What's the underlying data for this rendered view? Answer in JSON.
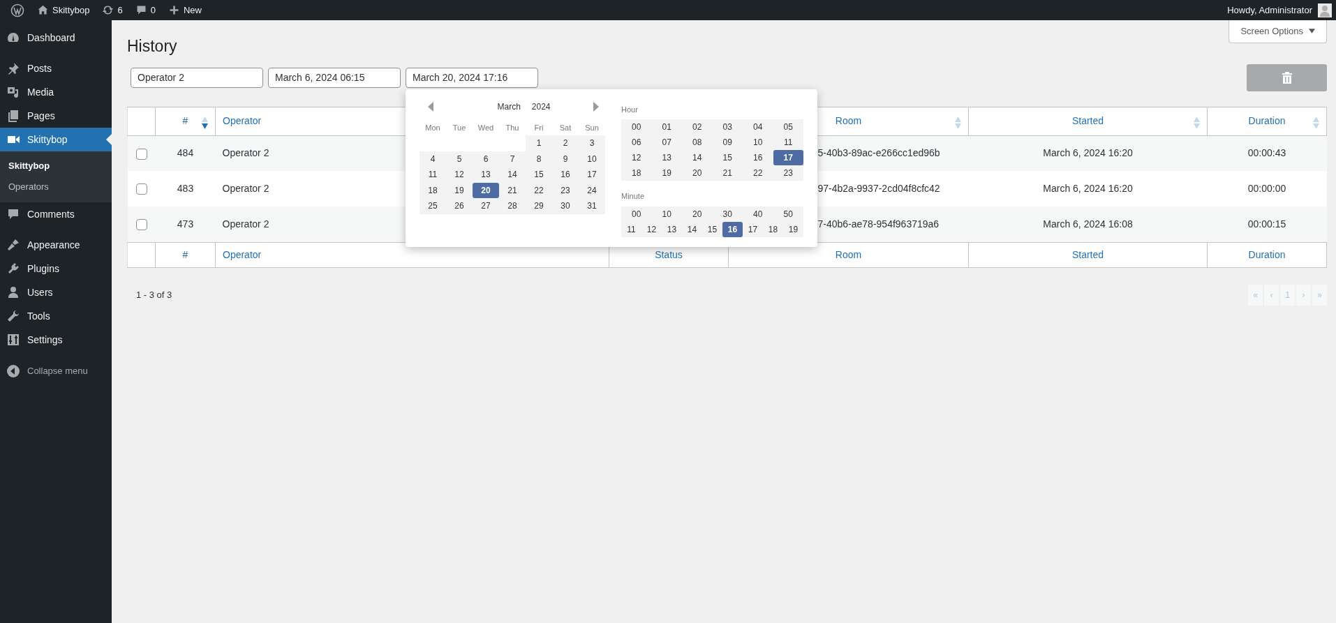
{
  "admin_bar": {
    "items": [
      {
        "kind": "logo"
      },
      {
        "kind": "home",
        "label": "Skittybop"
      },
      {
        "kind": "updates",
        "label": "6"
      },
      {
        "kind": "comments",
        "label": "0"
      },
      {
        "kind": "new",
        "label": "New"
      }
    ],
    "greeting": "Howdy, Administrator"
  },
  "sidebar": {
    "items": [
      {
        "kind": "dashboard",
        "label": "Dashboard",
        "selected": false
      },
      {
        "kind": "posts",
        "label": "Posts",
        "selected": false
      },
      {
        "kind": "media",
        "label": "Media",
        "selected": false
      },
      {
        "kind": "pages",
        "label": "Pages",
        "selected": false
      },
      {
        "kind": "video",
        "label": "Skittybop",
        "selected": true,
        "children": [
          {
            "label": "Skittybop",
            "selected": true
          },
          {
            "label": "Operators",
            "selected": false
          }
        ]
      },
      {
        "kind": "comments",
        "label": "Comments",
        "selected": false
      },
      {
        "kind": "appearance",
        "label": "Appearance",
        "selected": false
      },
      {
        "kind": "plugins",
        "label": "Plugins",
        "selected": false
      },
      {
        "kind": "users",
        "label": "Users",
        "selected": false
      },
      {
        "kind": "tools",
        "label": "Tools",
        "selected": false
      },
      {
        "kind": "settings",
        "label": "Settings",
        "selected": false
      }
    ],
    "collapse": "Collapse menu"
  },
  "screen_options": "Screen Options",
  "page_title": "History",
  "filters": [
    {
      "value": "Operator 2",
      "open": false
    },
    {
      "value": "March 6, 2024 06:15",
      "open": false
    },
    {
      "value": "March 20, 2024 17:16",
      "open": true
    }
  ],
  "delete_button": {
    "disabled": true
  },
  "date_picker": {
    "month": "March",
    "year": "2024",
    "weekdays": [
      "Mon",
      "Tue",
      "Wed",
      "Thu",
      "Fri",
      "Sat",
      "Sun"
    ],
    "weeks": [
      [
        {
          "kind": "blank"
        },
        {
          "kind": "blank"
        },
        {
          "kind": "blank"
        },
        {
          "kind": "blank"
        },
        {
          "day": "1",
          "selected": false
        },
        {
          "day": "2",
          "selected": false
        },
        {
          "day": "3",
          "selected": false
        }
      ],
      [
        {
          "day": "4",
          "selected": false
        },
        {
          "day": "5",
          "selected": false
        },
        {
          "day": "6",
          "selected": false
        },
        {
          "day": "7",
          "selected": false
        },
        {
          "day": "8",
          "selected": false
        },
        {
          "day": "9",
          "selected": false
        },
        {
          "day": "10",
          "selected": false
        }
      ],
      [
        {
          "day": "11",
          "selected": false
        },
        {
          "day": "12",
          "selected": false
        },
        {
          "day": "13",
          "selected": false
        },
        {
          "day": "14",
          "selected": false
        },
        {
          "day": "15",
          "selected": false
        },
        {
          "day": "16",
          "selected": false
        },
        {
          "day": "17",
          "selected": false
        }
      ],
      [
        {
          "day": "18",
          "selected": false
        },
        {
          "day": "19",
          "selected": false
        },
        {
          "day": "20",
          "selected": true
        },
        {
          "day": "21",
          "selected": false
        },
        {
          "day": "22",
          "selected": false
        },
        {
          "day": "23",
          "selected": false
        },
        {
          "day": "24",
          "selected": false
        }
      ],
      [
        {
          "day": "25",
          "selected": false
        },
        {
          "day": "26",
          "selected": false
        },
        {
          "day": "27",
          "selected": false
        },
        {
          "day": "28",
          "selected": false
        },
        {
          "day": "29",
          "selected": false
        },
        {
          "day": "30",
          "selected": false
        },
        {
          "day": "31",
          "selected": false
        }
      ]
    ],
    "hour_label": "Hour",
    "hours": [
      {
        "label": "00",
        "selected": false
      },
      {
        "label": "01",
        "selected": false
      },
      {
        "label": "02",
        "selected": false
      },
      {
        "label": "03",
        "selected": false
      },
      {
        "label": "04",
        "selected": false
      },
      {
        "label": "05",
        "selected": false
      },
      {
        "label": "06",
        "selected": false
      },
      {
        "label": "07",
        "selected": false
      },
      {
        "label": "08",
        "selected": false
      },
      {
        "label": "09",
        "selected": false
      },
      {
        "label": "10",
        "selected": false
      },
      {
        "label": "11",
        "selected": false
      },
      {
        "label": "12",
        "selected": false
      },
      {
        "label": "13",
        "selected": false
      },
      {
        "label": "14",
        "selected": false
      },
      {
        "label": "15",
        "selected": false
      },
      {
        "label": "16",
        "selected": false
      },
      {
        "label": "17",
        "selected": true
      },
      {
        "label": "18",
        "selected": false
      },
      {
        "label": "19",
        "selected": false
      },
      {
        "label": "20",
        "selected": false
      },
      {
        "label": "21",
        "selected": false
      },
      {
        "label": "22",
        "selected": false
      },
      {
        "label": "23",
        "selected": false
      }
    ],
    "minute_label": "Minute",
    "minute_rows": [
      [
        {
          "label": "00",
          "selected": false
        },
        {
          "label": "10",
          "selected": false
        },
        {
          "label": "20",
          "selected": false
        },
        {
          "label": "30",
          "selected": false
        },
        {
          "label": "40",
          "selected": false
        },
        {
          "label": "50",
          "selected": false
        }
      ],
      [
        {
          "label": "11",
          "selected": false
        },
        {
          "label": "12",
          "selected": false
        },
        {
          "label": "13",
          "selected": false
        },
        {
          "label": "14",
          "selected": false
        },
        {
          "label": "15",
          "selected": false
        },
        {
          "label": "16",
          "selected": true
        },
        {
          "label": "17",
          "selected": false
        },
        {
          "label": "18",
          "selected": false
        },
        {
          "label": "19",
          "selected": false
        }
      ]
    ]
  },
  "table": {
    "header": [
      {
        "label": "#",
        "sorted": true
      },
      {
        "label": "Operator"
      },
      {
        "label": "Room",
        "sorted": false
      },
      {
        "label": "Started",
        "sorted": false
      },
      {
        "label": "Duration",
        "sorted": false
      }
    ],
    "rows": [
      {
        "checked": false,
        "id": "484",
        "operator": "Operator 2",
        "room": "5-40b3-89ac-e266cc1ed96b",
        "started": "March 6, 2024 16:20",
        "duration": "00:00:43"
      },
      {
        "checked": false,
        "id": "483",
        "operator": "Operator 2",
        "room": "97-4b2a-9937-2cd04f8cfc42",
        "started": "March 6, 2024 16:20",
        "duration": "00:00:00"
      },
      {
        "checked": false,
        "id": "473",
        "operator": "Operator 2",
        "room": "7-40b6-ae78-954f963719a6",
        "started": "March 6, 2024 16:08",
        "duration": "00:00:15"
      }
    ],
    "footer": [
      "#",
      "Operator",
      "Status",
      "Room",
      "Started",
      "Duration"
    ]
  },
  "summary": "1 - 3 of 3",
  "pagination": [
    {
      "label": "«",
      "disabled": true
    },
    {
      "label": "‹",
      "disabled": true
    },
    {
      "label": "1",
      "disabled": true
    },
    {
      "label": "›",
      "disabled": true
    },
    {
      "label": "»",
      "disabled": true
    }
  ]
}
